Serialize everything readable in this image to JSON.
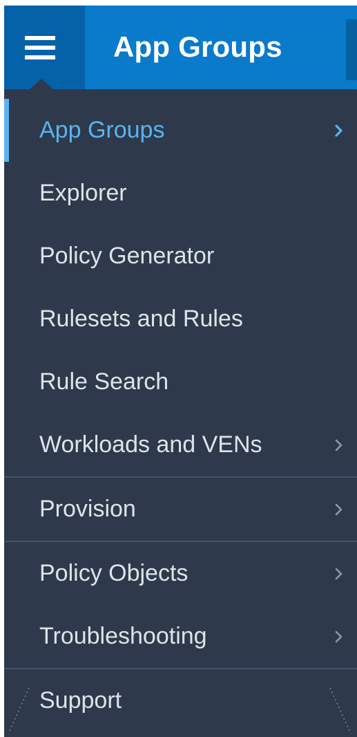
{
  "header": {
    "title": "App Groups",
    "menu_icon": "hamburger-icon"
  },
  "colors": {
    "header_bg": "#0a7acb",
    "toggle_bg": "#0562a9",
    "menu_bg": "#2e3a4b",
    "active": "#5ab3f0",
    "text": "#dde3ea",
    "divider": "#44536a"
  },
  "menu": {
    "items": [
      {
        "label": "App Groups",
        "active": true,
        "has_submenu": true
      },
      {
        "label": "Explorer",
        "active": false,
        "has_submenu": false
      },
      {
        "label": "Policy Generator",
        "active": false,
        "has_submenu": false
      },
      {
        "label": "Rulesets and Rules",
        "active": false,
        "has_submenu": false
      },
      {
        "label": "Rule Search",
        "active": false,
        "has_submenu": false
      },
      {
        "label": "Workloads and VENs",
        "active": false,
        "has_submenu": true
      },
      {
        "label": "Provision",
        "active": false,
        "has_submenu": true
      },
      {
        "label": "Policy Objects",
        "active": false,
        "has_submenu": true
      },
      {
        "label": "Troubleshooting",
        "active": false,
        "has_submenu": true
      },
      {
        "label": "Support",
        "active": false,
        "has_submenu": false
      }
    ]
  }
}
